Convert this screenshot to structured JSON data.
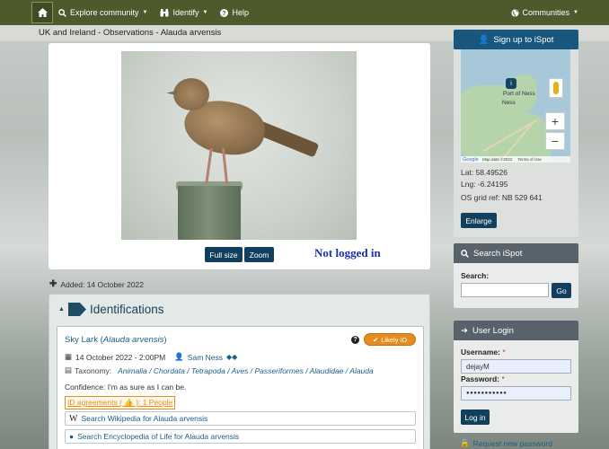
{
  "nav": {
    "explore_label": "Explore community",
    "identify_label": "Identify",
    "help_label": "Help",
    "communities_label": "Communities"
  },
  "breadcrumb_title": "UK and Ireland - Observations - Alauda arvensis",
  "photo": {
    "full_size_label": "Full size",
    "zoom_label": "Zoom",
    "overlay_text": "Not logged in"
  },
  "added_text": "Added: 14 October 2022",
  "identifications": {
    "heading": "Identifications",
    "card": {
      "common_name": "Sky Lark",
      "scientific_name": "Alauda arvensis",
      "likely_label": "Likely ID",
      "date": "14 October 2022 - 2:00PM",
      "user": "Sam Ness",
      "taxonomy_label": "Taxonomy:",
      "taxonomy": [
        "Animalia",
        "Chordata",
        "Tetrapoda",
        "Aves",
        "Passeriformes",
        "Alaudidae",
        "Alauda"
      ],
      "confidence": "Confidence:   I'm as sure as I can be.",
      "agreements": "ID agreements ( 👍 ): 1 People",
      "wiki_search": "Search Wikipedia for Alauda arvensis",
      "eol_search": "Search Encyclopedia of Life for Alauda arvensis"
    }
  },
  "sidebar": {
    "signup_label": "Sign up to iSpot",
    "map": {
      "place_label_1": "Port of Ness",
      "place_label_2": "Ness",
      "google_label": "Google",
      "map_data": "Map data ©2022",
      "terms": "Terms of Use",
      "zoom_in": "+",
      "zoom_out": "−"
    },
    "lat": "Lat: 58.49526",
    "lng": "Lng: -6.24195",
    "grid_ref": "OS grid ref: NB 529 641",
    "enlarge_label": "Enlarge",
    "search": {
      "heading": "Search iSpot",
      "label": "Search:",
      "value": "",
      "go_label": "Go"
    },
    "login": {
      "heading": "User Login",
      "username_label": "Username:",
      "username_value": "dejayM",
      "password_label": "Password:",
      "password_value": "●●●●●●●●●●●",
      "button_label": "Log in",
      "request_label": "Request new password",
      "required_mark": "*"
    }
  },
  "colors": {
    "nav_bg": "#4d5b2c",
    "primary_button": "#123f5e",
    "signup_button": "#19587e",
    "likely_badge": "#e48c1f",
    "link": "#1b5e86",
    "not_logged_text": "#1d2fae"
  }
}
